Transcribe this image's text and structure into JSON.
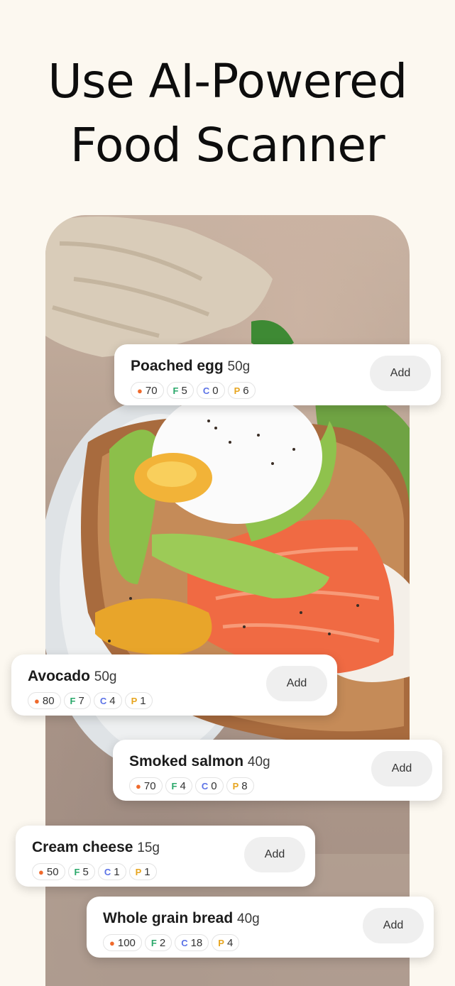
{
  "headline": {
    "line1": "Use AI-Powered",
    "line2": "Food Scanner"
  },
  "colors": {
    "background": "#fcf8f0",
    "card": "#ffffff",
    "button": "#efefef",
    "fire": "#ef6a2c",
    "fat": "#2aa86a",
    "carbs": "#5b72e6",
    "protein": "#e7a51f"
  },
  "chip_labels": {
    "fire_icon": "fire-icon",
    "fat": "F",
    "carbs": "C",
    "protein": "P"
  },
  "items": [
    {
      "name": "Poached egg",
      "weight": "50g",
      "kcal": "70",
      "fat": "5",
      "carbs": "0",
      "protein": "6",
      "add_label": "Add"
    },
    {
      "name": "Avocado",
      "weight": "50g",
      "kcal": "80",
      "fat": "7",
      "carbs": "4",
      "protein": "1",
      "add_label": "Add"
    },
    {
      "name": "Smoked salmon",
      "weight": "40g",
      "kcal": "70",
      "fat": "4",
      "carbs": "0",
      "protein": "8",
      "add_label": "Add"
    },
    {
      "name": "Cream cheese",
      "weight": "15g",
      "kcal": "50",
      "fat": "5",
      "carbs": "1",
      "protein": "1",
      "add_label": "Add"
    },
    {
      "name": "Whole grain bread",
      "weight": "40g",
      "kcal": "100",
      "fat": "2",
      "carbs": "18",
      "protein": "4",
      "add_label": "Add"
    }
  ]
}
